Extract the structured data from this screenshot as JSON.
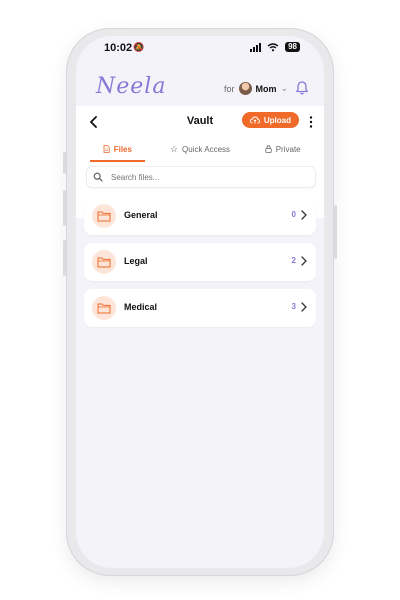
{
  "status_bar": {
    "time": "10:02",
    "battery": "98"
  },
  "brand": {
    "logo_text": "Neela"
  },
  "profile": {
    "for_label": "for",
    "name": "Mom"
  },
  "nav": {
    "title": "Vault",
    "upload_label": "Upload"
  },
  "tabs": [
    {
      "label": "Files",
      "active": true
    },
    {
      "label": "Quick Access",
      "active": false
    },
    {
      "label": "Private",
      "active": false
    }
  ],
  "search": {
    "placeholder": "Search files..."
  },
  "folders": [
    {
      "name": "General",
      "count": "0"
    },
    {
      "name": "Legal",
      "count": "2"
    },
    {
      "name": "Medical",
      "count": "3"
    }
  ],
  "colors": {
    "accent": "#f06a2a",
    "brand": "#8a78d6",
    "background": "#f5f3fa"
  }
}
